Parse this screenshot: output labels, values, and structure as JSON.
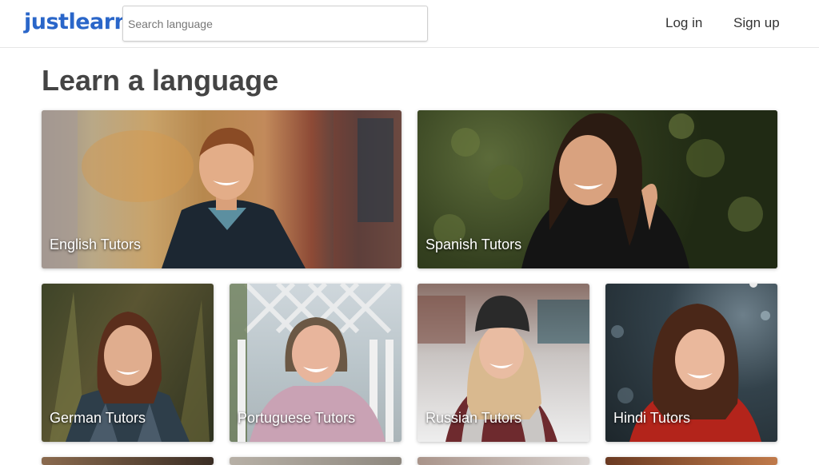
{
  "header": {
    "logo": "justlearn",
    "search_placeholder": "Search language",
    "login_label": "Log in",
    "signup_label": "Sign up"
  },
  "main": {
    "title": "Learn a language",
    "cards": [
      {
        "label": "English Tutors"
      },
      {
        "label": "Spanish Tutors"
      },
      {
        "label": "German Tutors"
      },
      {
        "label": "Portuguese Tutors"
      },
      {
        "label": "Russian Tutors"
      },
      {
        "label": "Hindi Tutors"
      }
    ]
  }
}
